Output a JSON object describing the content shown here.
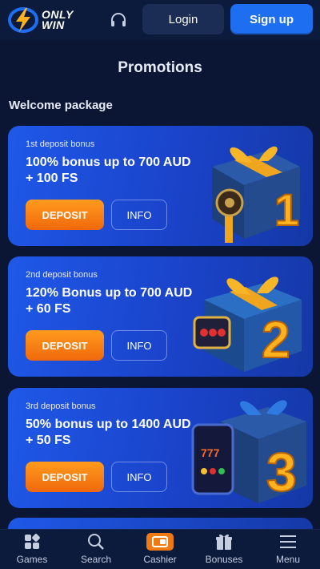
{
  "header": {
    "logo_line1": "ONLY",
    "logo_line2": "WIN",
    "login_label": "Login",
    "signup_label": "Sign up"
  },
  "page": {
    "title": "Promotions",
    "section_title": "Welcome package"
  },
  "promotions": [
    {
      "label": "1st deposit bonus",
      "title": "100% bonus up to 700 AUD + 100 FS",
      "deposit_label": "DEPOSIT",
      "info_label": "INFO",
      "gift_number": "1"
    },
    {
      "label": "2nd deposit bonus",
      "title": "120% Bonus up to 700 AUD + 60 FS",
      "deposit_label": "DEPOSIT",
      "info_label": "INFO",
      "gift_number": "2"
    },
    {
      "label": "3rd deposit bonus",
      "title": "50% bonus up to 1400 AUD + 50 FS",
      "deposit_label": "DEPOSIT",
      "info_label": "INFO",
      "gift_number": "3"
    }
  ],
  "bottom_nav": [
    {
      "label": "Games",
      "icon": "grid-icon"
    },
    {
      "label": "Search",
      "icon": "search-icon"
    },
    {
      "label": "Cashier",
      "icon": "wallet-icon"
    },
    {
      "label": "Bonuses",
      "icon": "gift-icon"
    },
    {
      "label": "Menu",
      "icon": "menu-icon"
    }
  ],
  "colors": {
    "background": "#0a1634",
    "card": "#1f58e8",
    "accent_orange": "#f0680c",
    "signup_blue": "#1e6ef2"
  }
}
